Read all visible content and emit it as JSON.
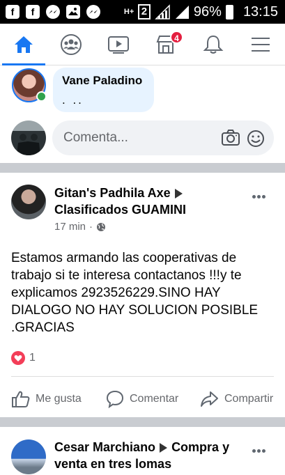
{
  "status_bar": {
    "network_type": "H+",
    "sim_slot": "2",
    "battery_percent": "96%",
    "time": "13:15",
    "left_icons": [
      "facebook-icon",
      "facebook-icon",
      "messenger-icon",
      "gallery-icon",
      "messenger-icon"
    ]
  },
  "nav": {
    "tabs": [
      "home-icon",
      "groups-icon",
      "watch-icon",
      "marketplace-icon",
      "notifications-icon",
      "menu-icon"
    ],
    "active": "home-icon",
    "marketplace_badge": "4"
  },
  "comment": {
    "author": "Vane Paladino",
    "text": ". .."
  },
  "comment_input": {
    "placeholder": "Comenta..."
  },
  "post": {
    "author": "Gitan's Padhila Axe",
    "group": "Clasificados GUAMINI",
    "time": "17 min",
    "privacy_icon": "globe-icon",
    "body": "Estamos armando las cooperativas de trabajo si te interesa contactanos !!!y te explicamos 2923526229.SINO HAY DIALOGO NO HAY SOLUCION POSIBLE .GRACIAS",
    "reaction_count": "1",
    "actions": {
      "like": "Me gusta",
      "comment": "Comentar",
      "share": "Compartir"
    }
  },
  "next_post": {
    "author": "Cesar Marchiano",
    "group": "Compra y venta en tres lomas"
  },
  "colors": {
    "brand_blue": "#1877f2",
    "badge_red": "#e41e3f",
    "online_green": "#31a24c",
    "love_red": "#f33e58",
    "divider_gray": "#c9ccd1"
  }
}
